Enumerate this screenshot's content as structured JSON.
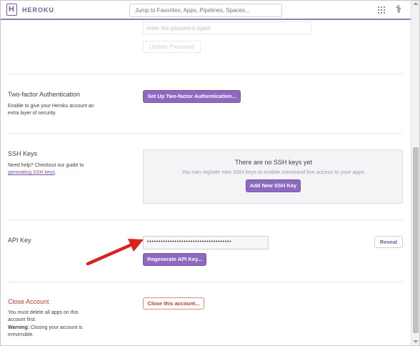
{
  "header": {
    "brand": "HEROKU",
    "logo_letter": "H",
    "search_placeholder": "Jump to Favorites, Apps, Pipelines, Spaces...",
    "avatar_glyph": "⚕"
  },
  "password": {
    "confirm_placeholder": "enter the password again",
    "update_label": "Update Password"
  },
  "two_factor": {
    "title": "Two-factor Authentication",
    "description": "Enable to give your Heroku account an extra layer of security.",
    "button_label": "Set Up Two-factor Authentication..."
  },
  "ssh_keys": {
    "title": "SSH Keys",
    "description_prefix": "Need help? Checkout our guide to ",
    "description_link": "generating SSH keys",
    "description_suffix": ".",
    "empty_title": "There are no SSH keys yet",
    "empty_subtitle": "You can register new SSH keys to enable command line access to your apps.",
    "add_button_label": "Add New SSH Key"
  },
  "api_key": {
    "title": "API Key",
    "masked_value": "•••••••••••••••••••••••••••••••••••••",
    "reveal_label": "Reveal",
    "regenerate_label": "Regenerate API Key..."
  },
  "close_account": {
    "title": "Close Account",
    "description_1": "You must delete all apps on this account first.",
    "warning_label": "Warning:",
    "warning_text": " Closing your account is irreversible.",
    "button_label": "Close this account..."
  },
  "colors": {
    "accent": "#79589f",
    "button_purple": "#8e69c2",
    "danger": "#c0392b",
    "annotation_arrow": "#d9221c"
  }
}
